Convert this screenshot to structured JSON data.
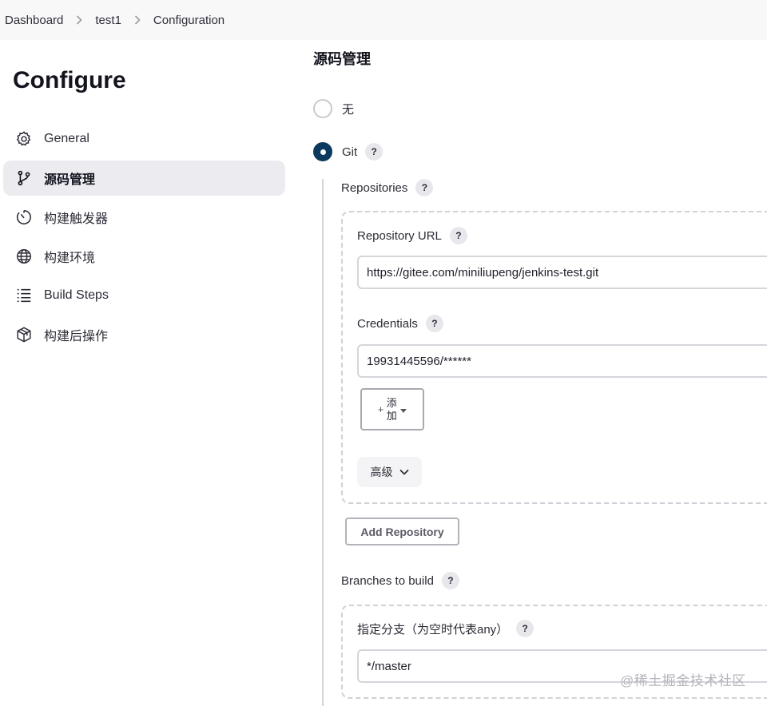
{
  "breadcrumb": {
    "items": [
      "Dashboard",
      "test1",
      "Configuration"
    ]
  },
  "page_title": "Configure",
  "sidebar": {
    "items": [
      {
        "label": "General",
        "icon": "gear-icon"
      },
      {
        "label": "源码管理",
        "icon": "branch-icon",
        "active": true
      },
      {
        "label": "构建触发器",
        "icon": "timer-icon"
      },
      {
        "label": "构建环境",
        "icon": "globe-icon"
      },
      {
        "label": "Build Steps",
        "icon": "list-icon"
      },
      {
        "label": "构建后操作",
        "icon": "package-icon"
      }
    ]
  },
  "scm": {
    "title": "源码管理",
    "option_none": "无",
    "option_git": "Git",
    "selected": "Git",
    "help_symbol": "?",
    "repositories_label": "Repositories",
    "repository_url_label": "Repository URL",
    "repository_url_value": "https://gitee.com/miniliupeng/jenkins-test.git",
    "credentials_label": "Credentials",
    "credentials_value": "19931445596/******",
    "add_plus": "+",
    "add_label": "添加",
    "advanced_label": "高级",
    "add_repository_label": "Add Repository",
    "branches_label": "Branches to build",
    "branch_specifier_label": "指定分支（为空时代表any）",
    "branch_specifier_value": "*/master"
  },
  "watermark": "@稀土掘金技术社区",
  "colors": {
    "accent": "#0b3a5e",
    "active_nav_bg": "#ebebf0"
  }
}
